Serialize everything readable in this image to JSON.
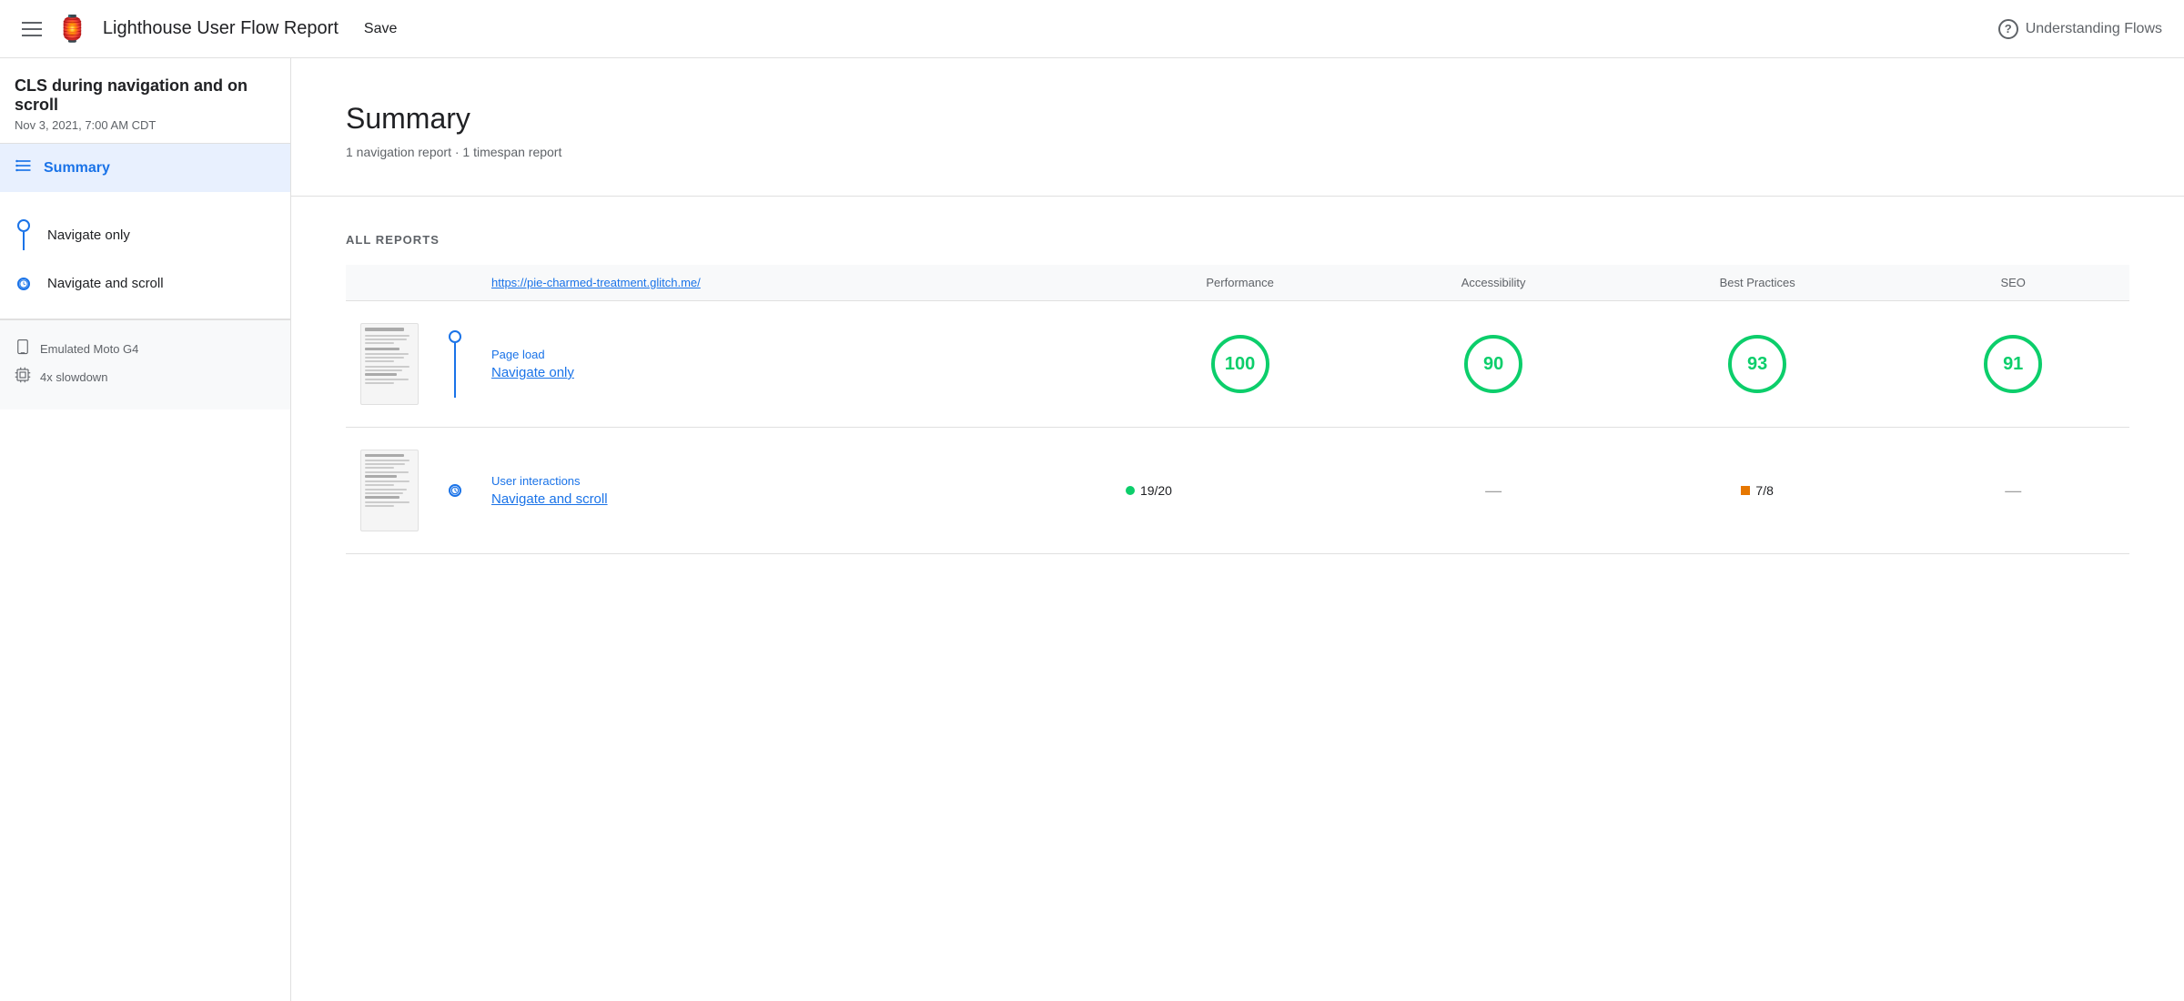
{
  "header": {
    "hamburger_label": "menu",
    "logo": "🏮",
    "title": "Lighthouse User Flow Report",
    "save_label": "Save",
    "help_icon": "?",
    "understanding_flows": "Understanding Flows"
  },
  "sidebar": {
    "report_title": "CLS during navigation and on scroll",
    "report_date": "Nov 3, 2021, 7:00 AM CDT",
    "summary_label": "Summary",
    "nav_items": [
      {
        "label": "Navigate only",
        "type": "dot"
      },
      {
        "label": "Navigate and scroll",
        "type": "clock"
      }
    ],
    "device_items": [
      {
        "icon": "laptop",
        "label": "Emulated Moto G4"
      },
      {
        "icon": "cpu",
        "label": "4x slowdown"
      }
    ]
  },
  "main": {
    "summary": {
      "heading": "Summary",
      "sub": "1 navigation report · 1 timespan report"
    },
    "reports": {
      "section_label": "ALL REPORTS",
      "url": "https://pie-charmed-treatment.glitch.me/",
      "columns": [
        "Performance",
        "Accessibility",
        "Best Practices",
        "SEO"
      ],
      "rows": [
        {
          "type": "Page load",
          "name": "Navigate only",
          "timeline_type": "dot",
          "scores": [
            {
              "kind": "circle",
              "value": "100",
              "color": "green"
            },
            {
              "kind": "circle",
              "value": "90",
              "color": "green"
            },
            {
              "kind": "circle",
              "value": "93",
              "color": "green"
            },
            {
              "kind": "circle",
              "value": "91",
              "color": "green"
            }
          ]
        },
        {
          "type": "User interactions",
          "name": "Navigate and scroll",
          "timeline_type": "clock",
          "scores": [
            {
              "kind": "dot-score",
              "value": "19/20",
              "color": "green"
            },
            {
              "kind": "dash"
            },
            {
              "kind": "square-score",
              "value": "7/8",
              "color": "orange"
            },
            {
              "kind": "dash"
            }
          ]
        }
      ]
    }
  }
}
